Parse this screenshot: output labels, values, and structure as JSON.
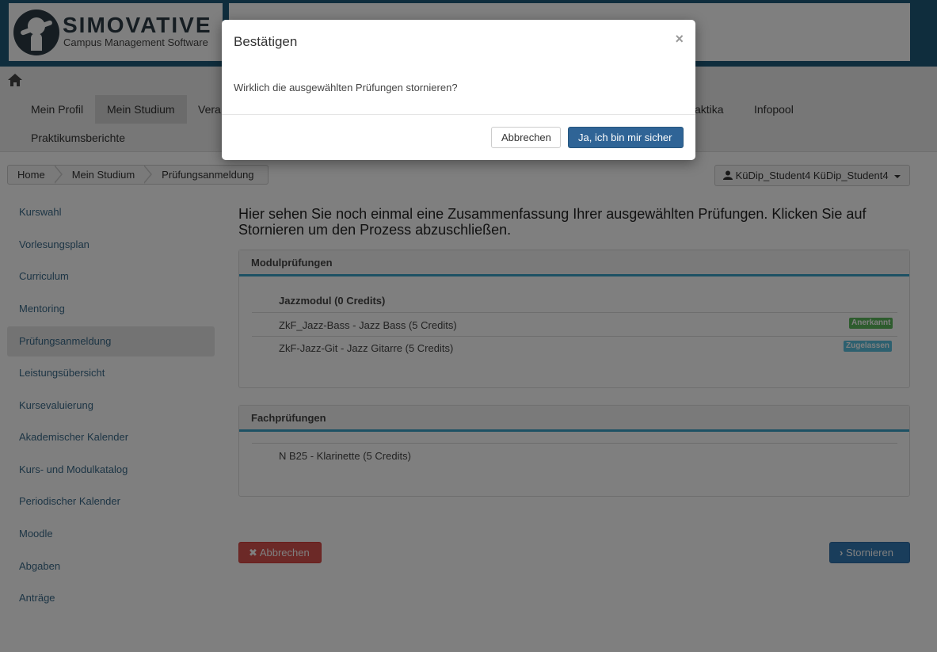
{
  "header": {
    "logo_title": "SIMOVATIVE",
    "logo_subtitle": "Campus Management Software"
  },
  "nav": {
    "row1": [
      "Mein Profil",
      "Mein Studium",
      "Vera",
      "aktika",
      "Infopool"
    ],
    "row2": [
      "Praktikumsberichte"
    ]
  },
  "breadcrumb": [
    "Home",
    "Mein Studium",
    "Prüfungsanmeldung"
  ],
  "user": {
    "name": "KüDip_Student4 KüDip_Student4"
  },
  "sidebar": {
    "items": [
      "Kurswahl",
      "Vorlesungsplan",
      "Curriculum",
      "Mentoring",
      "Prüfungsanmeldung",
      "Leistungsübersicht",
      "Kursevaluierung",
      "Akademischer Kalender",
      "Kurs- und Modulkatalog",
      "Periodischer Kalender",
      "Moodle",
      "Abgaben",
      "Anträge"
    ]
  },
  "main": {
    "intro": "Hier sehen Sie noch einmal eine Zusammenfassung Ihrer ausgewählten Prüfungen. Klicken Sie auf Stornieren um den Prozess abzuschließen.",
    "modul_panel": {
      "title": "Modulprüfungen",
      "group": "Jazzmodul (0 Credits)",
      "rows": [
        {
          "text": "ZkF_Jazz-Bass - Jazz Bass (5 Credits)",
          "badge": "Anerkannt"
        },
        {
          "text": "ZkF-Jazz-Git - Jazz Gitarre (5 Credits)",
          "badge": "Zugelassen"
        }
      ]
    },
    "fach_panel": {
      "title": "Fachprüfungen",
      "rows": [
        {
          "text": "N B25 - Klarinette (5 Credits)"
        }
      ]
    },
    "cancel_label": "Abbrechen",
    "storno_label": "Stornieren"
  },
  "modal": {
    "title": "Bestätigen",
    "close": "×",
    "message": "Wirklich die ausgewählten Prüfungen stornieren?",
    "cancel_label": "Abbrechen",
    "confirm_label": "Ja, ich bin mir sicher"
  },
  "colors": {
    "header_bg": "#1f5a7a",
    "accent": "#3aa3c8",
    "danger": "#d9534f",
    "primary": "#337ab7"
  }
}
